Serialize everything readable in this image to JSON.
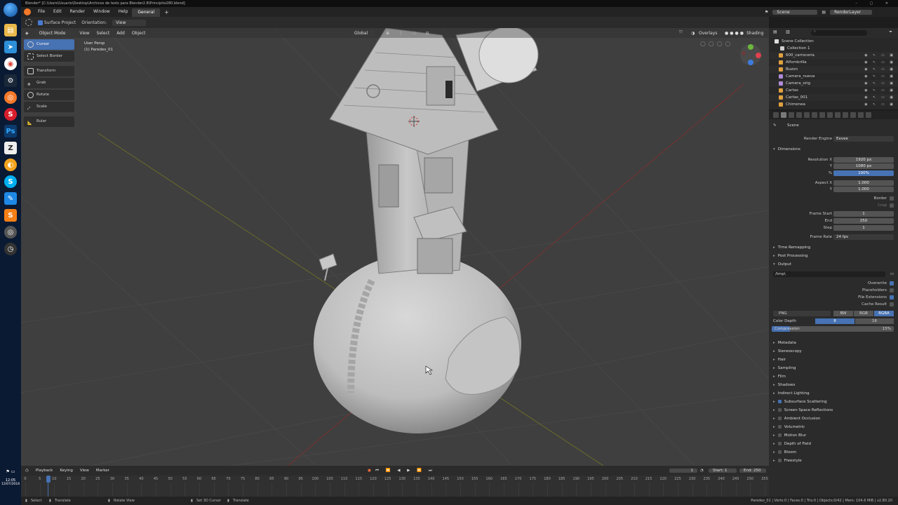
{
  "window": {
    "title": "Blender* [C:\\Users\\Usuario\\Desktop\\Archivos de tests para Blender2.8\\Principito280.blend]"
  },
  "menus": [
    "File",
    "Edit",
    "Render",
    "Window",
    "Help"
  ],
  "workspace_tab": "General",
  "scene_selector": "Scene",
  "view_layer_selector": "RenderLayer",
  "tool_header": {
    "surface_project": "Surface Project",
    "orientation_label": "Orientation:",
    "orientation_value": "View"
  },
  "viewport_header": {
    "mode": "Object Mode",
    "menus": [
      "View",
      "Select",
      "Add",
      "Object"
    ],
    "transform": "Global",
    "overlays": "Overlays",
    "shading": "Shading"
  },
  "toolshelf": [
    {
      "label": "Cursor",
      "active": true
    },
    {
      "label": "Select Border",
      "active": false
    },
    {
      "label": "Transform",
      "active": false
    },
    {
      "label": "Grab",
      "active": false
    },
    {
      "label": "Rotate",
      "active": false
    },
    {
      "label": "Scale",
      "active": false
    },
    {
      "label": "Ruler",
      "active": false
    }
  ],
  "viewport_info": {
    "view": "User Persp",
    "object": "(1) Paredes_01"
  },
  "outliner": {
    "root": "Scene Collection",
    "items": [
      {
        "name": "Collection 1",
        "color": "#cfcfcf"
      },
      {
        "name": "600_carroceria",
        "color": "#e0a040"
      },
      {
        "name": "Alfombrilla",
        "color": "#e0a040"
      },
      {
        "name": "Buzon",
        "color": "#e0a040"
      },
      {
        "name": "Camera_nueva",
        "color": "#b08bd8"
      },
      {
        "name": "Camera_orig",
        "color": "#b08bd8"
      },
      {
        "name": "Cartas",
        "color": "#e0a040"
      },
      {
        "name": "Cartas_001",
        "color": "#e0a040"
      },
      {
        "name": "Chimenea",
        "color": "#e0a040"
      }
    ]
  },
  "properties": {
    "scene": "Scene",
    "render_engine_label": "Render Engine",
    "render_engine": "Eevee",
    "dimensions": "Dimensions",
    "resolution_x_label": "Resolution X",
    "resolution_x": "1920 px",
    "y_label": "Y",
    "resolution_y": "1080 px",
    "percent_label": "%",
    "percent": "100%",
    "aspect_x_label": "Aspect X",
    "aspect_x": "1.000",
    "aspect_y": "1.000",
    "border": "Border",
    "crop": "Crop",
    "frame_start_label": "Frame Start",
    "frame_start": "1",
    "end_label": "End",
    "frame_end": "250",
    "step_label": "Step",
    "frame_step": "1",
    "frame_rate_label": "Frame Rate",
    "frame_rate": "24 fps",
    "time_remapping": "Time Remapping",
    "post_processing": "Post Processing",
    "output": "Output",
    "output_path": "/tmp\\",
    "overwrite": "Overwrite",
    "placeholders": "Placeholders",
    "file_extensions": "File Extensions",
    "cache_result": "Cache Result",
    "format": "PNG",
    "bw": "BW",
    "rgb": "RGB",
    "rgba": "RGBA",
    "color_depth_label": "Color Depth",
    "color_depth_8": "8",
    "color_depth_16": "16",
    "compression_label": "Compression",
    "compression": "15%",
    "collapsed_sections": [
      "Metadata",
      "Stereoscopy",
      "Hair",
      "Sampling",
      "Film",
      "Shadows",
      "Indirect Lighting"
    ],
    "checkbox_sections": [
      {
        "label": "Subsurface Scattering",
        "on": true
      },
      {
        "label": "Screen Space Reflections",
        "on": false
      },
      {
        "label": "Ambient Occlusion",
        "on": false
      },
      {
        "label": "Volumetric",
        "on": false
      },
      {
        "label": "Motion Blur",
        "on": false
      },
      {
        "label": "Depth of Field",
        "on": false
      },
      {
        "label": "Bloom",
        "on": false
      },
      {
        "label": "Freestyle",
        "on": false
      }
    ]
  },
  "timeline": {
    "menus": [
      "Playback",
      "Keying",
      "View",
      "Marker"
    ],
    "current_frame": "1",
    "start_label": "Start:",
    "start": "1",
    "end_label": "End:",
    "end": "250",
    "ticks": [
      "0",
      "5",
      "10",
      "15",
      "20",
      "25",
      "30",
      "35",
      "40",
      "45",
      "50",
      "55",
      "60",
      "65",
      "70",
      "75",
      "80",
      "85",
      "90",
      "95",
      "100",
      "105",
      "110",
      "115",
      "120",
      "125",
      "130",
      "135",
      "140",
      "145",
      "150",
      "155",
      "160",
      "165",
      "170",
      "175",
      "180",
      "185",
      "190",
      "195",
      "200",
      "205",
      "210",
      "215",
      "220",
      "225",
      "230",
      "235",
      "240",
      "245",
      "250",
      "255"
    ]
  },
  "statusbar": {
    "select": "Select",
    "translate": "Translate",
    "rotate_view": "Rotate View",
    "set_3d_cursor": "Set 3D Cursor",
    "translate2": "Translate",
    "stats": "Paredes_01 | Verts:0 | Faces:0 | Tris:0 | Objects:0/42 | Mem: 104.6 MiB | v2.80.20"
  },
  "tray": {
    "time": "12:05",
    "date": "12/07/2018"
  }
}
